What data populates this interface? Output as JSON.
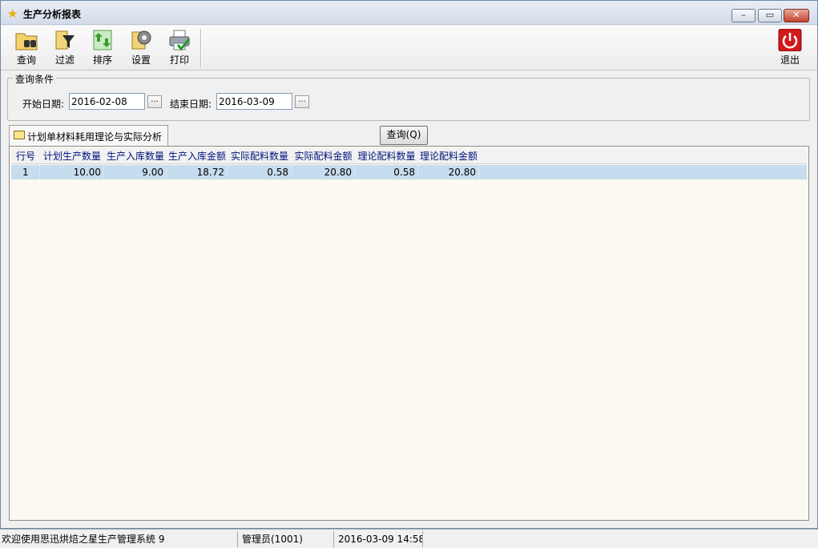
{
  "window": {
    "title": "生产分析报表",
    "controls": {
      "minimize": "–",
      "maximize": "▭",
      "close": "✕"
    }
  },
  "toolbar": {
    "items": [
      {
        "label": "查询",
        "icon": "binoculars-folder-icon"
      },
      {
        "label": "过滤",
        "icon": "funnel-filter-icon"
      },
      {
        "label": "排序",
        "icon": "sort-arrows-icon"
      },
      {
        "label": "设置",
        "icon": "gear-icon"
      },
      {
        "label": "打印",
        "icon": "printer-icon"
      }
    ],
    "exit": {
      "label": "退出",
      "icon": "power-icon"
    }
  },
  "query": {
    "legend": "查询条件",
    "start_label": "开始日期:",
    "start_value": "2016-02-08",
    "end_label": "结束日期:",
    "end_value": "2016-03-09",
    "picker_label": "..."
  },
  "tab": {
    "label": "计划单材料耗用理论与实际分析"
  },
  "query_button": "查询(Q)",
  "grid": {
    "columns": [
      "行号",
      "计划生产数量",
      "生产入库数量",
      "生产入库金额",
      "实际配料数量",
      "实际配料金额",
      "理论配料数量",
      "理论配料金额"
    ],
    "rows": [
      [
        "1",
        "10.00",
        "9.00",
        "18.72",
        "0.58",
        "20.80",
        "0.58",
        "20.80"
      ]
    ]
  },
  "status": {
    "welcome": "欢迎使用思迅烘焙之星生产管理系统 9",
    "user": "管理员(1001)",
    "datetime": "2016-03-09 14:58"
  },
  "colors": {
    "header_text": "#00137a",
    "selected_row": "#c6dcef",
    "grid_bg": "#fbf9f1",
    "exit_red": "#d11a1a"
  }
}
